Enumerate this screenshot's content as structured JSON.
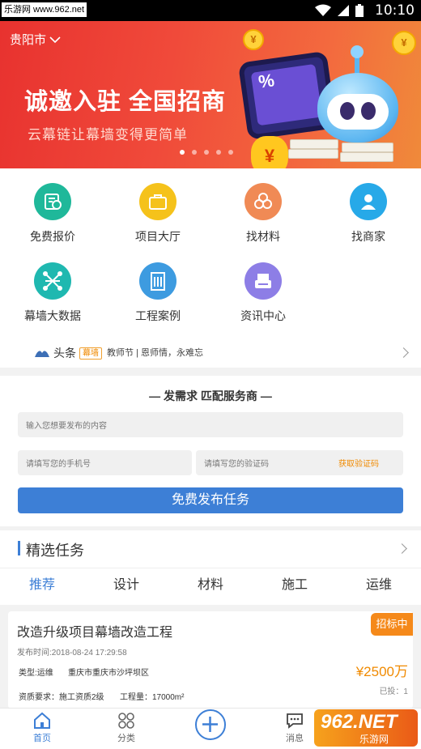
{
  "status_bar": {
    "watermark": "乐游网 www.962.net",
    "time": "10:10"
  },
  "banner": {
    "city": "贵阳市",
    "slogan": "诚邀入驻 全国招商",
    "subslogan": "云幕链让幕墙变得更简单",
    "coin_symbol": "¥",
    "screen_symbol": "%"
  },
  "grid": [
    {
      "label": "免费报价",
      "color": "#1fb89a",
      "icon": "quote-icon"
    },
    {
      "label": "项目大厅",
      "color": "#f5c21b",
      "icon": "briefcase-icon"
    },
    {
      "label": "找材料",
      "color": "#f08a55",
      "icon": "coins-icon"
    },
    {
      "label": "找商家",
      "color": "#27a9e8",
      "icon": "person-icon"
    },
    {
      "label": "幕墙大数据",
      "color": "#1fb8b0",
      "icon": "network-icon"
    },
    {
      "label": "工程案例",
      "color": "#3d9be0",
      "icon": "building-icon"
    },
    {
      "label": "资讯中心",
      "color": "#8d7ee6",
      "icon": "news-icon"
    }
  ],
  "ticker": {
    "title": "头条",
    "tag": "幕墙",
    "text": "教师节 | 恩师情，永难忘"
  },
  "form": {
    "title": "—    发需求  匹配服务商    —",
    "content_placeholder": "输入您想要发布的内容",
    "phone_placeholder": "请填写您的手机号",
    "code_placeholder": "请填写您的验证码",
    "get_code": "获取验证码",
    "submit": "免费发布任务"
  },
  "selected": {
    "title": "精选任务",
    "tabs": [
      "推荐",
      "设计",
      "材料",
      "施工",
      "运维"
    ],
    "active_tab": 0
  },
  "task": {
    "title": "改造升级项目幕墙改造工程",
    "badge": "招标中",
    "published": "发布时间:2018-08-24 17:29:58",
    "type": "类型:运维",
    "location": "重庆市重庆市沙坪坝区",
    "qualification": "资质要求：施工资质2级",
    "workload": "工程量：17000m²",
    "price": "¥2500万",
    "bids": "已投：1"
  },
  "nav": {
    "items": [
      {
        "label": "首页",
        "icon": "home-icon",
        "active": true
      },
      {
        "label": "分类",
        "icon": "category-icon",
        "active": false
      },
      {
        "label": "消息",
        "icon": "message-icon",
        "active": false
      }
    ]
  },
  "watermark_bottom": {
    "big": "962.NET",
    "small": "乐游网"
  },
  "colors": {
    "accent": "#3d7fd6",
    "banner": "#ea3b32",
    "orange": "#f08a00"
  }
}
